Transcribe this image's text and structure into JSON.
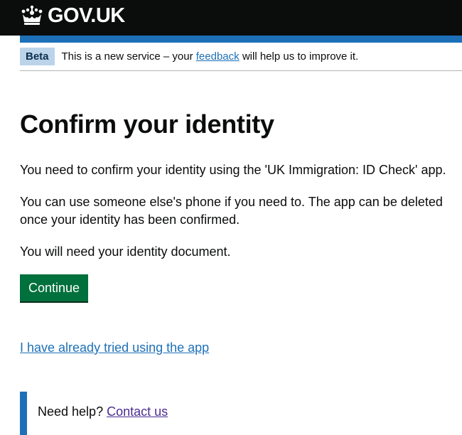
{
  "header": {
    "logo_text": "GOV.UK",
    "logo_icon": "crown-icon",
    "background_color": "#0b0c0c",
    "accent_color": "#1d70b8"
  },
  "phase_banner": {
    "tag": "Beta",
    "text_before": "This is a new service – your ",
    "link": "feedback",
    "text_after": " will help us to improve it."
  },
  "main": {
    "title": "Confirm your identity",
    "paragraphs": [
      "You need to confirm your identity using the 'UK Immigration: ID Check' app.",
      "You can use someone else's phone if you need to. The app can be deleted once your identity has been confirmed.",
      "You will need your identity document."
    ],
    "continue_button": "Continue",
    "button_color": "#00703c",
    "tried_link": "I have already tried using the app"
  },
  "help": {
    "text": "Need help? ",
    "link": "Contact us"
  }
}
